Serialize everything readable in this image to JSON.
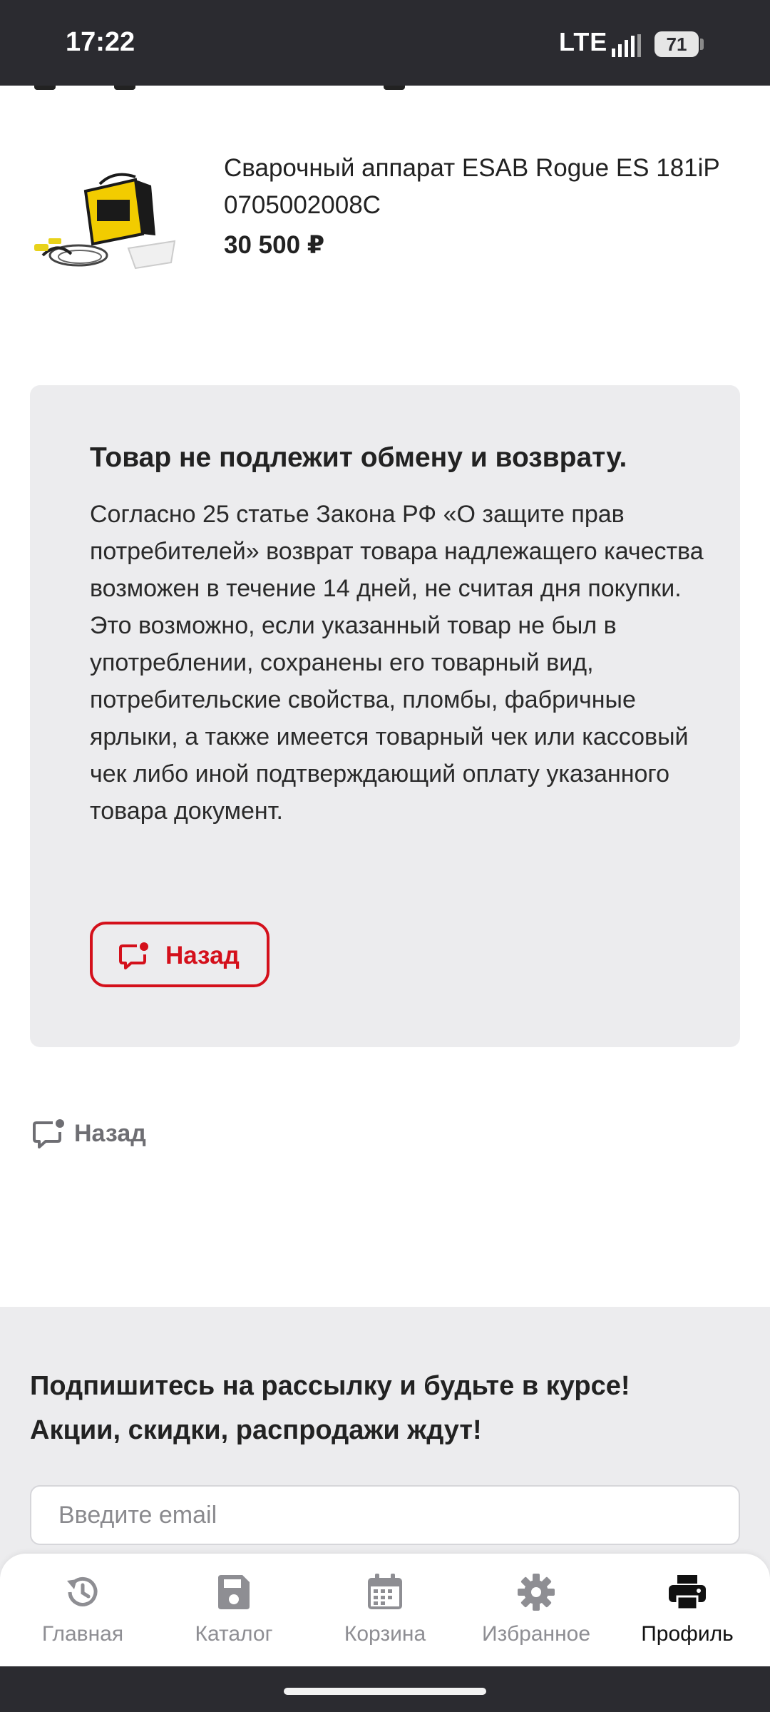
{
  "status_bar": {
    "time": "17:22",
    "network": "LTE",
    "battery": "71"
  },
  "product": {
    "name": "Сварочный аппарат ESAB Rogue ES 181iP 0705002008C",
    "price": "30 500 ₽",
    "image_icon": "welding-machine-image"
  },
  "notice": {
    "title": "Товар не подлежит обмену и возврату.",
    "text": "Согласно 25 статье Закона РФ «О защите прав потребителей» возврат товара надлежащего качества возможен в течение 14 дней, не считая дня покупки. Это возможно, если указанный товар не был в употреблении, сохранены его товарный вид, потребительские свойства, пломбы, фабричные ярлыки, а также имеется товарный чек или кассовый чек либо иной подтверждающий оплату указанного товара документ.",
    "back_button_label": "Назад",
    "back_button_icon": "chat-notification-icon"
  },
  "back_link": {
    "label": "Назад",
    "icon": "chat-notification-icon"
  },
  "newsletter": {
    "title_line1": "Подпишитесь на рассылку и будьте в курсе!",
    "title_line2": "Акции, скидки, распродажи ждут!",
    "email_placeholder": "Введите email"
  },
  "bottom_nav": {
    "items": [
      {
        "label": "Главная",
        "icon": "history-icon"
      },
      {
        "label": "Каталог",
        "icon": "save-icon"
      },
      {
        "label": "Корзина",
        "icon": "calendar-icon"
      },
      {
        "label": "Избранное",
        "icon": "gear-icon"
      },
      {
        "label": "Профиль",
        "icon": "printer-icon",
        "active": true
      }
    ]
  },
  "colors": {
    "accent_red": "#d4101b",
    "panel_gray": "#ececee",
    "system_bar": "#2b2b30",
    "inactive_nav": "#8e8e93"
  }
}
